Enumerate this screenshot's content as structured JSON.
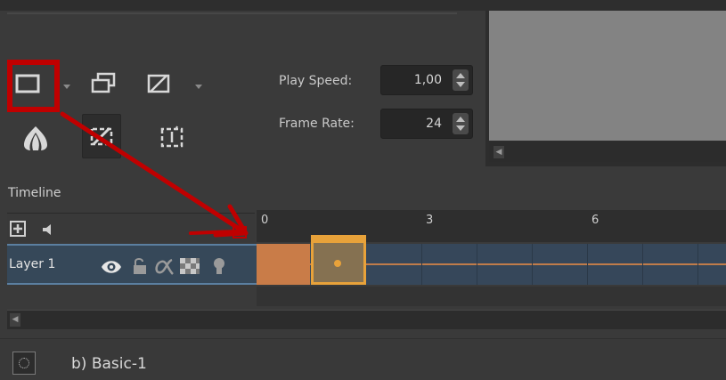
{
  "timeline": {
    "title": "Timeline",
    "play_speed": {
      "label": "Play Speed:",
      "value": "1,00"
    },
    "frame_rate": {
      "label": "Frame Rate:",
      "value": "24"
    },
    "ruler_ticks": [
      "0",
      "3",
      "6"
    ]
  },
  "layers": [
    {
      "name": "Layer 1"
    }
  ],
  "layer_icons": [
    "eye-icon",
    "lock-icon",
    "alpha-icon",
    "transparency-checker-icon",
    "bulb-icon"
  ],
  "toolbar_icons": [
    "add-frame-icon",
    "duplicate-frame-icon",
    "remove-frame-icon",
    "onion-skin-icon",
    "selected-keyframe-icon",
    "insert-hold-icon"
  ],
  "status": {
    "preset_name": "b) Basic-1"
  },
  "colors": {
    "annotation": "#c00000",
    "keyframe_accent": "#e8a23a",
    "active_frame_fill": "#c97c48",
    "layer_row": "#364859",
    "preview": "#838383"
  }
}
